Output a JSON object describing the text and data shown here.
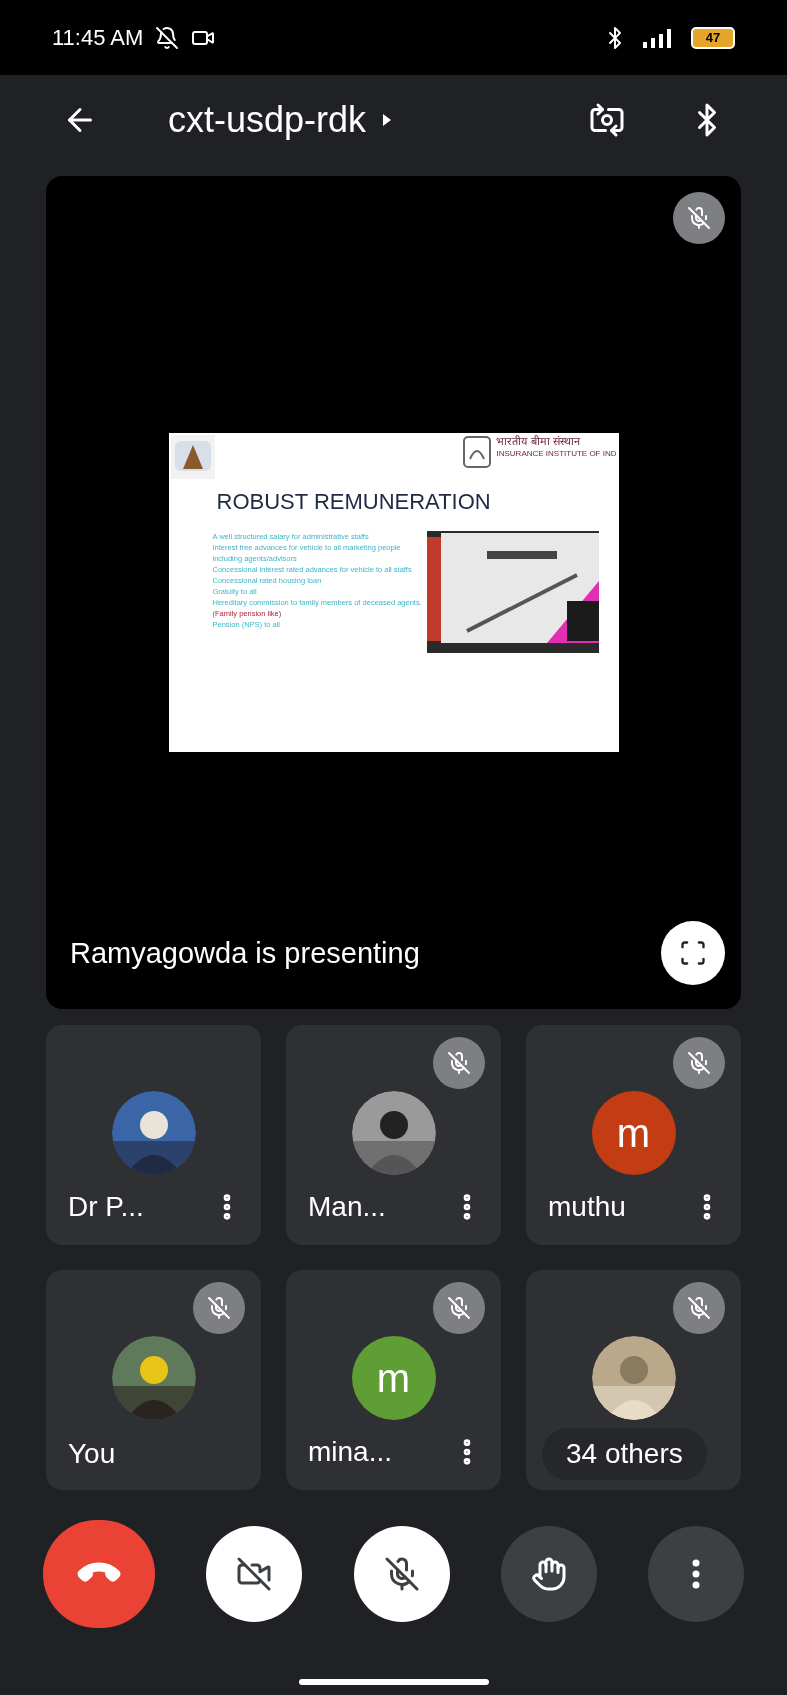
{
  "status_bar": {
    "time": "11:45 AM",
    "battery": "47"
  },
  "top_bar": {
    "title": "cxt-usdp-rdk"
  },
  "presentation": {
    "muted": true,
    "caption": "Ramyagowda is presenting",
    "slide": {
      "logo_hindi": "भारतीय बीमा संस्थान",
      "logo_english": "INSURANCE INSTITUTE OF IND",
      "title": "ROBUST REMUNERATION",
      "items": [
        {
          "text": "A well structured salary for administrative staffs"
        },
        {
          "text": "Interest free advances for vehicle to all marketing people including agents/advisors"
        },
        {
          "text": "Concessional interest rated advances for vehicle to all staffs"
        },
        {
          "text": "Concessional rated housing loan"
        },
        {
          "text": "Gratuity to all"
        },
        {
          "text": "Hereditary commission to family members of deceased agents.",
          "note": "(Family pension like)"
        },
        {
          "text": "Pension (NPS) to all"
        }
      ]
    }
  },
  "participants": [
    {
      "name": "Dr P...",
      "muted": false,
      "menu": true
    },
    {
      "name": "Man...",
      "muted": true,
      "menu": true
    },
    {
      "name": "muthu",
      "kind": "letter",
      "letter": "m",
      "color": "#c43c14",
      "muted": true,
      "menu": true
    },
    {
      "name": "You",
      "muted": true,
      "menu": false
    },
    {
      "name": "mina...",
      "kind": "letter",
      "letter": "m",
      "color": "#5f9e35",
      "muted": true,
      "menu": true
    },
    {
      "muted": true,
      "menu": false,
      "others": "34 others"
    }
  ],
  "controls": [
    {
      "kind": "end-call"
    },
    {
      "kind": "camera-off"
    },
    {
      "kind": "mic-off"
    },
    {
      "kind": "raise-hand"
    },
    {
      "kind": "more"
    }
  ]
}
